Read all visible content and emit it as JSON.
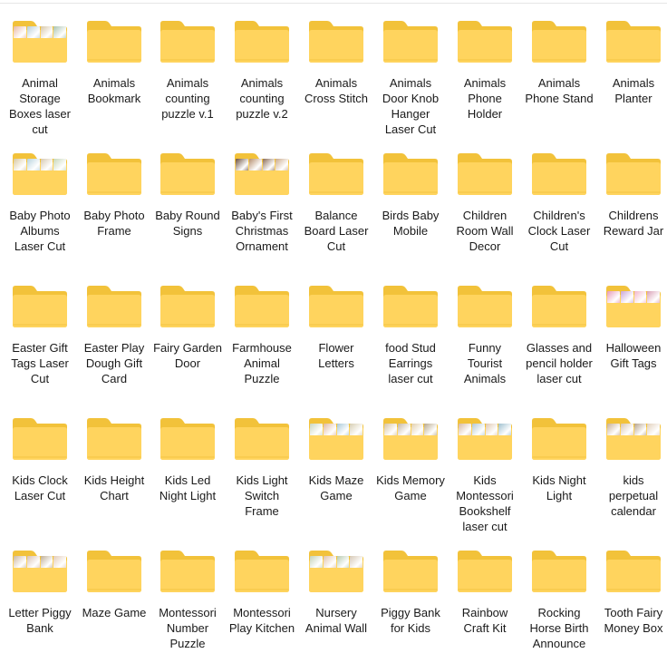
{
  "colors": {
    "folder_back": "#F2C23A",
    "folder_front": "#FFD45E",
    "folder_edge": "#E8B52A",
    "text": "#1a1a1a"
  },
  "folders": [
    {
      "name": "Animal Storage Boxes laser cut",
      "preview": true,
      "thumbs": [
        "#e9b9a4",
        "#b8cfd8",
        "#d8c7a8",
        "#a9c3b0"
      ]
    },
    {
      "name": "Animals Bookmark",
      "preview": false
    },
    {
      "name": "Animals counting puzzle v.1",
      "preview": false
    },
    {
      "name": "Animals counting puzzle v.2",
      "preview": false
    },
    {
      "name": "Animals Cross Stitch",
      "preview": false
    },
    {
      "name": "Animals Door Knob Hanger Laser Cut",
      "preview": false
    },
    {
      "name": "Animals Phone Holder",
      "preview": false
    },
    {
      "name": "Animals Phone Stand",
      "preview": false
    },
    {
      "name": "Animals Planter",
      "preview": false
    },
    {
      "name": "Baby Photo Albums Laser Cut",
      "preview": true,
      "thumbs": [
        "#d9c8a0",
        "#b8d3de",
        "#d6c9b2",
        "#c7d7b9"
      ]
    },
    {
      "name": "Baby Photo Frame",
      "preview": false
    },
    {
      "name": "Baby Round Signs",
      "preview": false
    },
    {
      "name": "Baby's First Christmas Ornament",
      "preview": true,
      "thumbs": [
        "#6b4e3a",
        "#b79070",
        "#8a6b55",
        "#caa98a"
      ]
    },
    {
      "name": "Balance Board Laser Cut",
      "preview": false
    },
    {
      "name": "Birds Baby Mobile",
      "preview": false
    },
    {
      "name": "Children Room Wall Decor",
      "preview": false
    },
    {
      "name": "Children's Clock Laser Cut",
      "preview": false
    },
    {
      "name": "Childrens Reward Jar",
      "preview": false
    },
    {
      "name": "Easter Gift Tags Laser Cut",
      "preview": false
    },
    {
      "name": "Easter Play Dough Gift Card",
      "preview": false
    },
    {
      "name": "Fairy Garden Door",
      "preview": false
    },
    {
      "name": "Farmhouse Animal Puzzle",
      "preview": false
    },
    {
      "name": "Flower Letters",
      "preview": false
    },
    {
      "name": "food Stud Earrings laser cut",
      "preview": false
    },
    {
      "name": "Funny Tourist Animals",
      "preview": false
    },
    {
      "name": "Glasses and pencil holder laser cut",
      "preview": false
    },
    {
      "name": "Halloween Gift Tags",
      "preview": true,
      "thumbs": [
        "#e89ab8",
        "#c9a6d8",
        "#f2b6c8",
        "#d99fb5"
      ]
    },
    {
      "name": "Kids Clock Laser Cut",
      "preview": false
    },
    {
      "name": "Kids Height Chart",
      "preview": false
    },
    {
      "name": "Kids Led Night Light",
      "preview": false
    },
    {
      "name": "Kids Light Switch Frame",
      "preview": false
    },
    {
      "name": "Kids Maze Game",
      "preview": true,
      "thumbs": [
        "#c9d7c2",
        "#e0b9a2",
        "#a9c9da",
        "#d8cfb4"
      ]
    },
    {
      "name": "Kids Memory Game",
      "preview": true,
      "thumbs": [
        "#d8c3a2",
        "#c5b8a6",
        "#e2cfae",
        "#b9a98d"
      ]
    },
    {
      "name": "Kids Montessori Bookshelf laser cut",
      "preview": true,
      "thumbs": [
        "#d7b9a3",
        "#b4c9d6",
        "#e1c8b0",
        "#9fc0cf"
      ]
    },
    {
      "name": "Kids Night Light",
      "preview": false
    },
    {
      "name": "kids perpetual calendar",
      "preview": true,
      "thumbs": [
        "#c9b096",
        "#d9c6b1",
        "#b7a38c",
        "#e2d0bc"
      ]
    },
    {
      "name": "Letter Piggy Bank",
      "preview": true,
      "thumbs": [
        "#cdb9a1",
        "#d9c2b3",
        "#bfae97",
        "#e3cbb8"
      ]
    },
    {
      "name": "Maze Game",
      "preview": false
    },
    {
      "name": "Montessori Number Puzzle",
      "preview": false
    },
    {
      "name": "Montessori Play Kitchen",
      "preview": false
    },
    {
      "name": "Nursery Animal Wall",
      "preview": true,
      "thumbs": [
        "#c4d3b8",
        "#e1c4ad",
        "#b7cbb0",
        "#d7c9b6"
      ]
    },
    {
      "name": "Piggy Bank for Kids",
      "preview": false
    },
    {
      "name": "Rainbow Craft Kit",
      "preview": false
    },
    {
      "name": "Rocking Horse Birth Announce",
      "preview": false
    },
    {
      "name": "Tooth Fairy Money Box",
      "preview": false
    }
  ]
}
